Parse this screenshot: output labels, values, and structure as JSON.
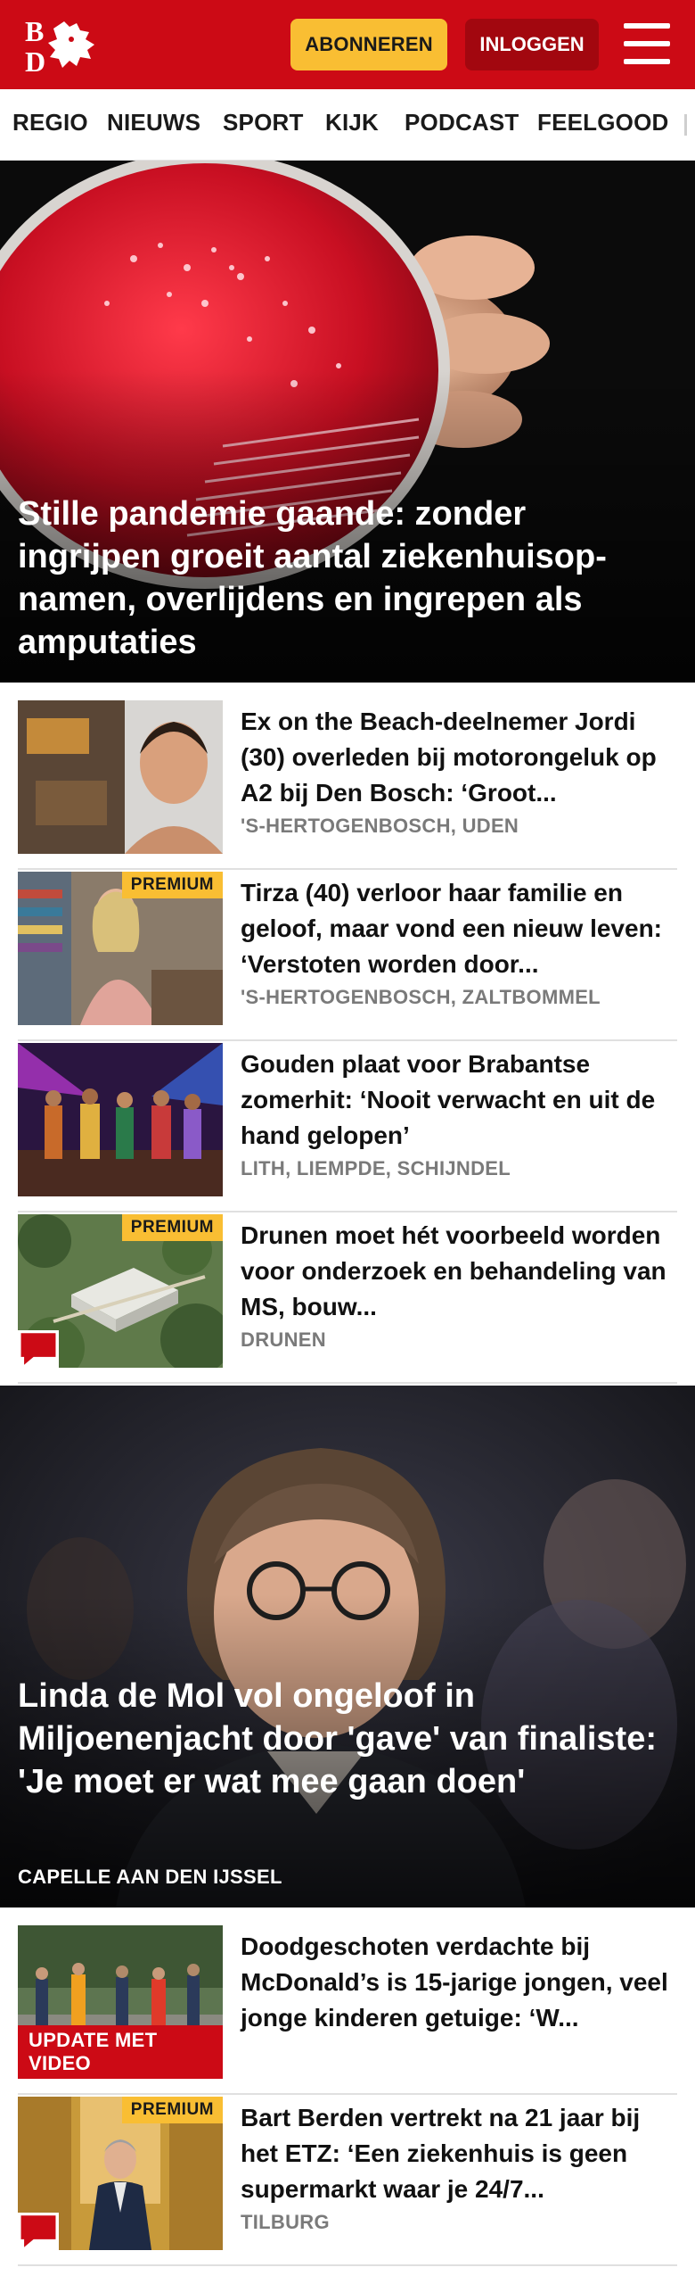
{
  "header": {
    "logo_text": "BD",
    "subscribe_label": "ABONNEREN",
    "login_label": "INLOGGEN"
  },
  "nav": {
    "items": [
      "REGIO",
      "NIEUWS",
      "SPORT",
      "KIJK",
      "PODCAST",
      "FEELGOOD"
    ]
  },
  "hero1": {
    "title": "Stille pandemie gaande: zonder ingrijpen groeit aantal ziekenhuisop-namen, overlijdens en ingrepen als amputaties"
  },
  "articles": [
    {
      "title": "Ex on the Beach-deelnemer Jordi (30) overleden bij motorongeluk op A2 bij Den Bosch: ‘Groot...",
      "location": "'S-HERTOGENBOSCH, UDEN"
    },
    {
      "title": "Tirza (40) verloor haar familie en geloof, maar vond een nieuw leven: ‘Verstoten worden door...",
      "location": "'S-HERTOGENBOSCH, ZALTBOMMEL",
      "badge": "PREMIUM"
    },
    {
      "title": "Gouden plaat voor Brabantse zomerhit: ‘Nooit verwacht en uit de hand gelopen’",
      "location": "LITH, LIEMPDE, SCHIJNDEL"
    },
    {
      "title": "Drunen moet hét voorbeeld worden voor onderzoek en behandeling van MS, bouw...",
      "location": "DRUNEN",
      "badge": "PREMIUM"
    }
  ],
  "hero2": {
    "title": "Linda de Mol vol ongeloof in Miljoenenjacht door 'gave' van finaliste: 'Je moet er wat mee gaan doen'",
    "location": "CAPELLE AAN DEN IJSSEL"
  },
  "articles2": [
    {
      "title": "Doodgeschoten verdachte bij McDonald’s is 15-jarige jongen, veel jonge kinderen getuige: ‘W...",
      "badge": "UPDATE MET VIDEO"
    },
    {
      "title": "Bart Berden vertrekt na 21 jaar bij het ETZ: ‘Een ziekenhuis is geen supermarkt waar je 24/7...",
      "location": "TILBURG",
      "badge": "PREMIUM"
    }
  ],
  "colors": {
    "brand_red": "#cc0a15",
    "login_red": "#a2070f",
    "accent_yellow": "#f9be33",
    "location_gray": "#7a7a7a"
  },
  "icons": [
    "bd-logo-icon",
    "menu-icon",
    "comment-icon"
  ]
}
